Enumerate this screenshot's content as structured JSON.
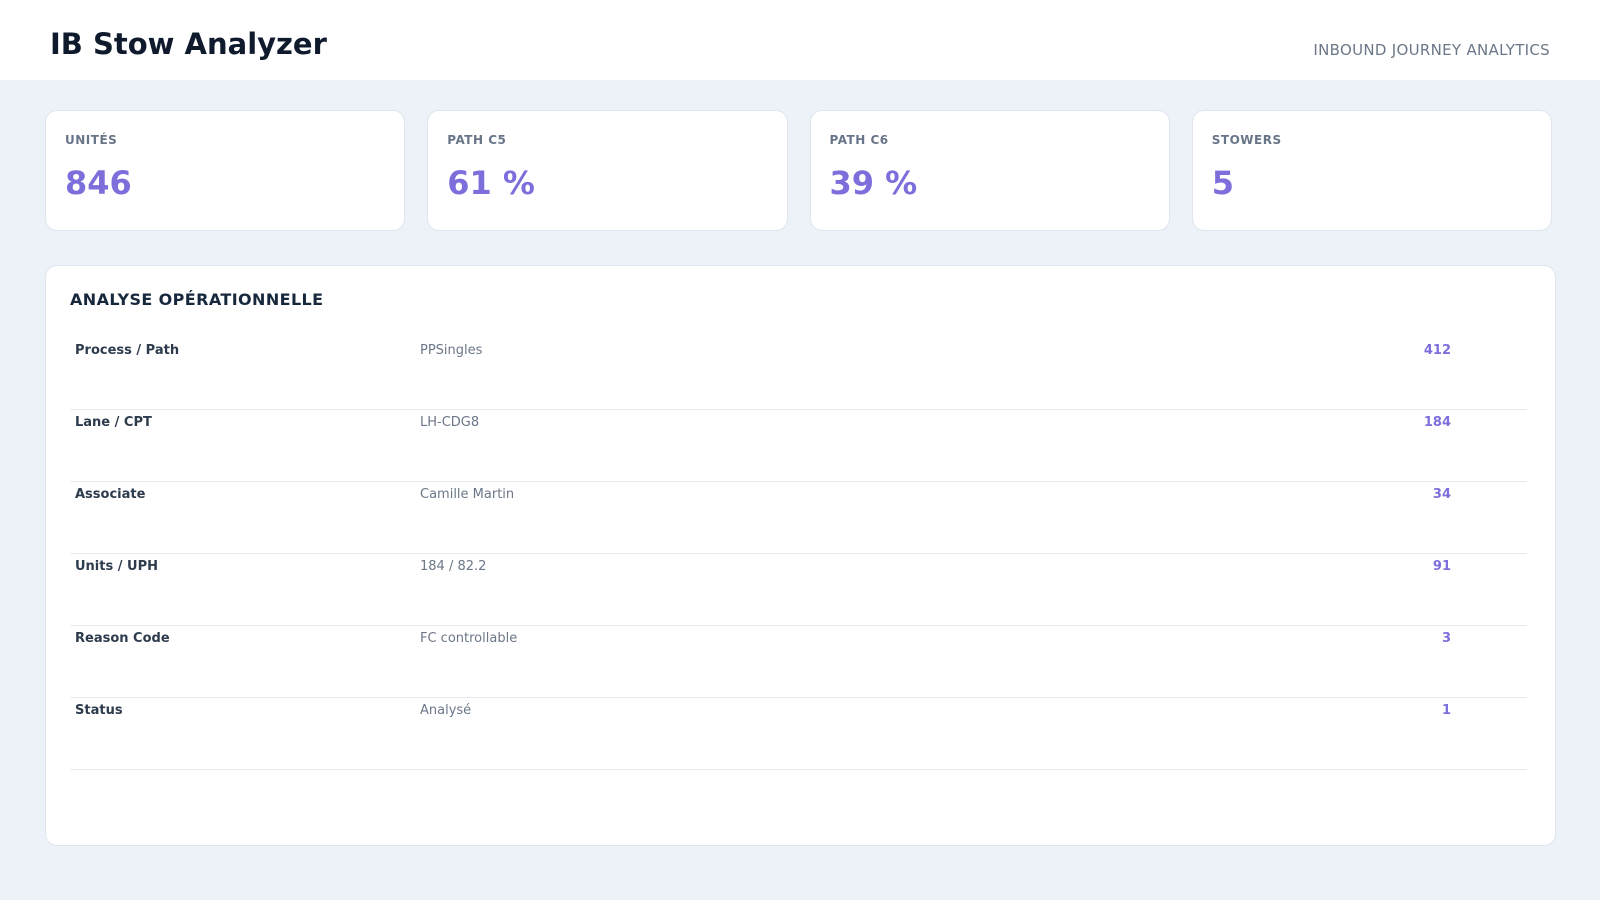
{
  "header": {
    "title": "IB Stow Analyzer",
    "subtitle": "INBOUND JOURNEY ANALYTICS"
  },
  "kpis": [
    {
      "label": "UNITÉS",
      "value": "846"
    },
    {
      "label": "PATH C5",
      "value": "61 %"
    },
    {
      "label": "PATH C6",
      "value": "39 %"
    },
    {
      "label": "STOWERS",
      "value": "5"
    }
  ],
  "panel": {
    "title": "ANALYSE OPÉRATIONNELLE",
    "rows": [
      {
        "label": "Process / Path",
        "value": "PPSingles",
        "count": "412"
      },
      {
        "label": "Lane / CPT",
        "value": "LH-CDG8",
        "count": "184"
      },
      {
        "label": "Associate",
        "value": "Camille Martin",
        "count": "34"
      },
      {
        "label": "Units / UPH",
        "value": "184 / 82.2",
        "count": "91"
      },
      {
        "label": "Reason Code",
        "value": "FC controllable",
        "count": "3"
      },
      {
        "label": "Status",
        "value": "Analysé",
        "count": "1"
      }
    ]
  },
  "colors": {
    "accent": "#7c6fdc",
    "background": "#edf2f8",
    "title": "#0f1b2d"
  }
}
